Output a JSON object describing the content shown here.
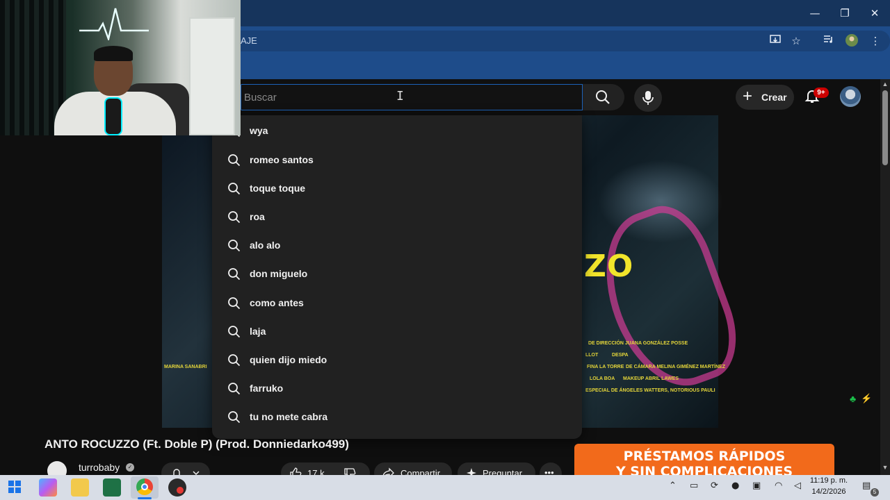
{
  "browser": {
    "omnibox_text": "AJE",
    "window_controls": {
      "minimize": "—",
      "restore": "❐",
      "close": "✕"
    },
    "toolbar_icons": [
      "install-icon",
      "star-icon",
      "media-icon",
      "profile-icon",
      "menu-icon"
    ]
  },
  "youtube": {
    "search": {
      "placeholder": "Buscar",
      "value": ""
    },
    "create_label": "Crear",
    "notifications_badge": "9+",
    "suggestions": [
      "wya",
      "romeo santos",
      "toque toque",
      "roa",
      "alo alo",
      "don miguelo",
      "como antes",
      "laja",
      "quien dijo miedo",
      "farruko",
      "tu no mete cabra"
    ],
    "video": {
      "title": "ANTO ROCUZZO (Ft. Doble P) (Prod. Donniedarko499)",
      "art_text": "ZO",
      "credits": [
        "DE DIRECCIÓN JUANA GONZÁLEZ POSSE",
        "LLOT",
        "DESPA",
        "FINA LA TORRE",
        "DE CÁMARA MELINA GIMÉNEZ MARTÍNEZ",
        "LOLA BOA",
        "MAKEUP ABRIL LAWES",
        "ESPECIAL DE ÁNGELES WATTERS, NOTORIOUS PAULI",
        "MARINA SANABRI"
      ]
    },
    "channel": {
      "name": "turrobaby"
    },
    "actions": {
      "likes": "17 k",
      "share": "Compartir",
      "ask": "Preguntar",
      "more": "•••"
    },
    "ad": {
      "line1": "PRÉSTAMOS RÁPIDOS",
      "line2": "Y SIN COMPLICACIONES"
    }
  },
  "taskbar": {
    "time": "11:19 p. m.",
    "date": "14/2/2026",
    "notification_count": "5"
  }
}
